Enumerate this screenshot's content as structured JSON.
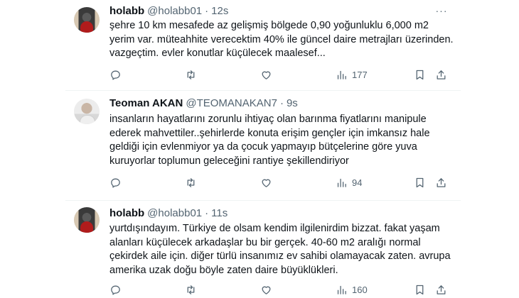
{
  "tweets": [
    {
      "name": "holabb",
      "handle": "@holabb01",
      "time": "12s",
      "lines": [
        "şehre 10 km mesafede az gelişmiş bölgede  0,90 yoğunluklu 6,000 m2",
        "yerim var. müteahhite verecektim 40% ile güncel daire metrajları üzerinden.",
        "vazgeçtim. evler konutlar küçülecek maalesef..."
      ],
      "views": "177"
    },
    {
      "name": "Teoman AKAN",
      "handle": "@TEOMANAKAN7",
      "time": "9s",
      "lines": [
        "insanların hayatlarını zorunlu ihtiyaç olan barınma fiyatlarını manipule",
        "ederek mahvettiler..şehirlerde konuta erişim gençler için imkansız hale",
        "geldiği için evlenmiyor ya da çocuk yapmayıp bütçelerine göre yuva",
        "kuruyorlar toplumun geleceğini rantiye şekillendiriyor"
      ],
      "views": "94"
    },
    {
      "name": "holabb",
      "handle": "@holabb01",
      "time": "11s",
      "lines": [
        "yurtdışındayım. Türkiye de olsam kendim ilgilenirdim bizzat. fakat yaşam",
        "alanları küçülecek arkadaşlar bu bir gerçek. 40-60 m2 aralığı normal",
        "çekirdek aile için. diğer türlü insanımız ev sahibi olamayacak zaten. avrupa",
        "amerika uzak doğu böyle zaten daire büyüklükleri."
      ],
      "views": "160"
    }
  ],
  "ui": {
    "separator": "·",
    "more_glyph": "···"
  },
  "icons": {
    "reply": "reply-icon",
    "retweet": "retweet-icon",
    "like": "like-icon",
    "views": "views-icon",
    "bookmark": "bookmark-icon",
    "share": "share-icon"
  }
}
